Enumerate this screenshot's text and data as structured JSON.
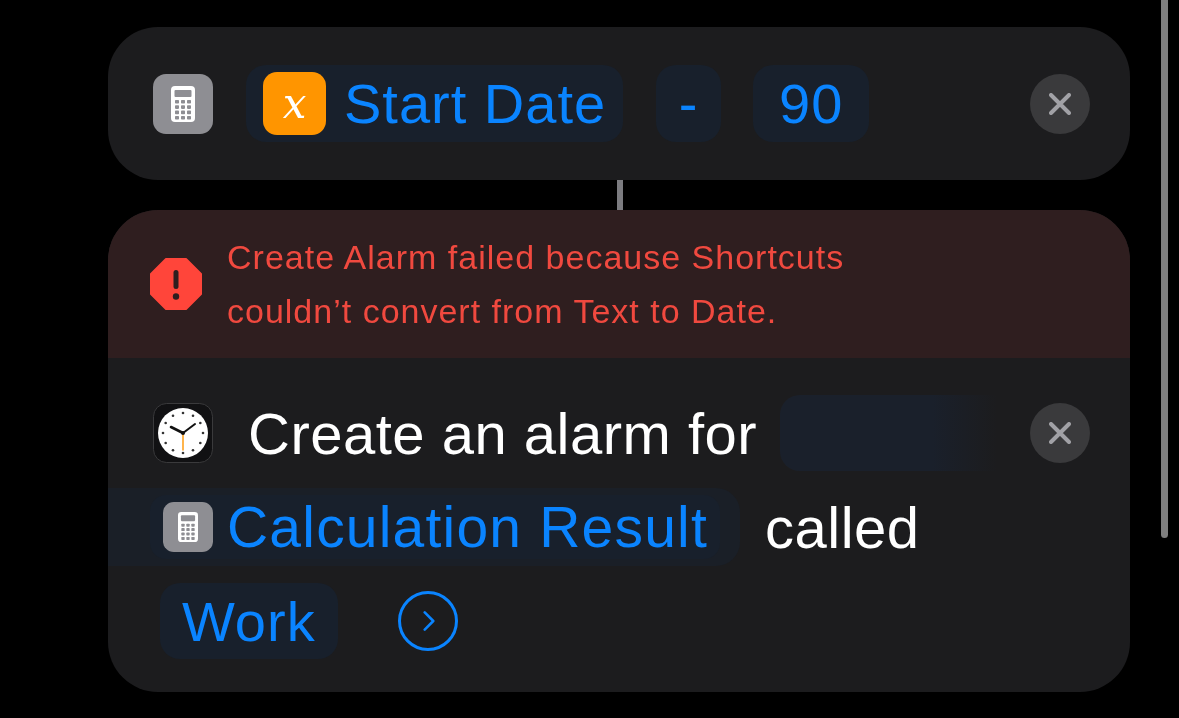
{
  "calculate_action": {
    "operand": {
      "symbol": "x",
      "label": "Start Date"
    },
    "operator": "-",
    "value": "90"
  },
  "alarm_action": {
    "error": {
      "message": "Create Alarm failed because Shortcuts couldn’t convert from Text to Date."
    },
    "lines": [
      [
        {
          "kind": "text",
          "text": "Create an alarm for"
        },
        {
          "kind": "field"
        }
      ],
      [
        {
          "kind": "variable",
          "text": "Calculation Result"
        },
        {
          "kind": "text",
          "text": "called"
        }
      ],
      [
        {
          "kind": "value",
          "text": "Work"
        },
        {
          "kind": "more"
        }
      ]
    ]
  }
}
